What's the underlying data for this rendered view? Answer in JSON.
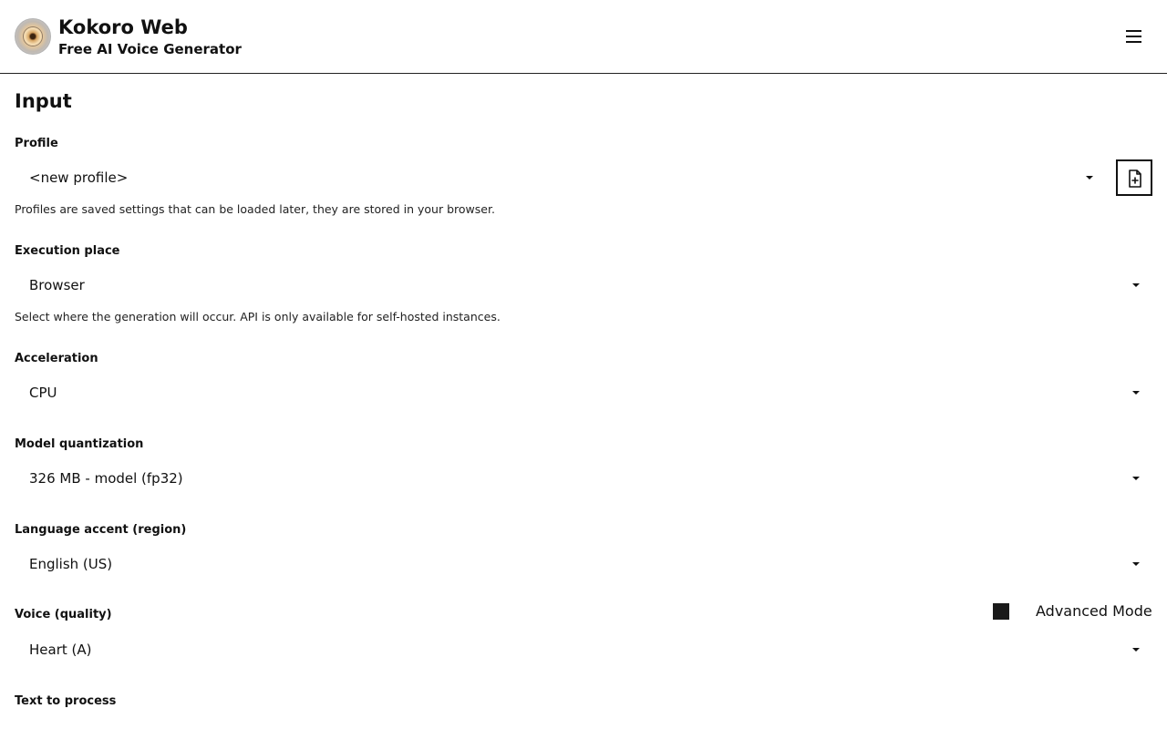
{
  "header": {
    "title": "Kokoro Web",
    "subtitle": "Free AI Voice Generator",
    "logo_icon": "speaker-logo-icon",
    "menu_icon": "hamburger-menu-icon"
  },
  "section_title": "Input",
  "profile": {
    "label": "Profile",
    "value": "<new profile>",
    "hint": "Profiles are saved settings that can be loaded later, they are stored in your browser.",
    "new_icon": "new-file-icon"
  },
  "execution_place": {
    "label": "Execution place",
    "value": "Browser",
    "hint": "Select where the generation will occur. API is only available for self-hosted instances."
  },
  "acceleration": {
    "label": "Acceleration",
    "value": "CPU"
  },
  "model_quantization": {
    "label": "Model quantization",
    "value": "326 MB - model (fp32)"
  },
  "language_accent": {
    "label": "Language accent (region)",
    "value": "English (US)"
  },
  "voice": {
    "label": "Voice (quality)",
    "value": "Heart (A)"
  },
  "advanced_mode": {
    "label": "Advanced Mode",
    "checked": true
  },
  "text_to_process": {
    "label": "Text to process"
  }
}
